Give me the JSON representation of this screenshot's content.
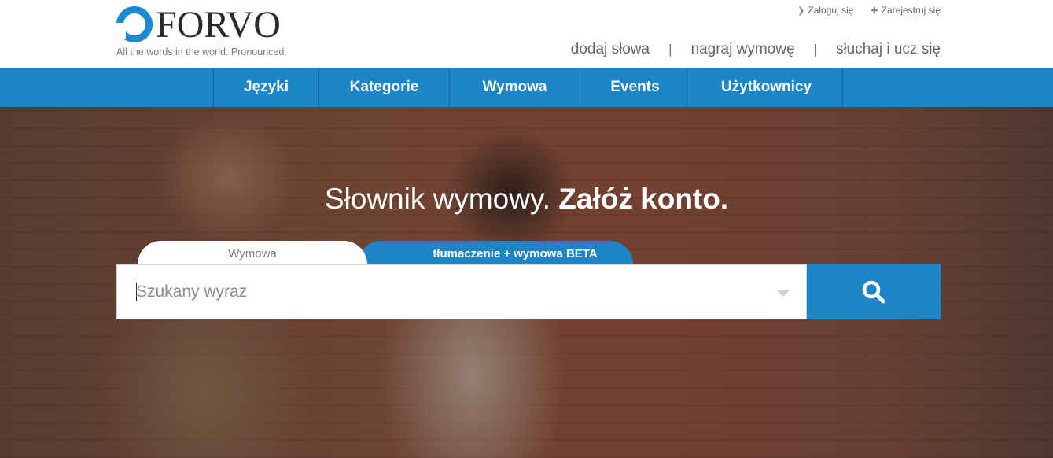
{
  "logo": {
    "name": "FORVO",
    "tagline": "All the words in the world. Pronounced."
  },
  "top_links": {
    "login": "Zaloguj się",
    "register": "Zarejestruj się"
  },
  "secondary_links": {
    "add_words": "dodaj słowa",
    "record": "nagraj wymowę",
    "listen": "słuchaj i ucz się",
    "separator": "|"
  },
  "nav": {
    "items": [
      {
        "label": "Języki"
      },
      {
        "label": "Kategorie"
      },
      {
        "label": "Wymowa"
      },
      {
        "label": "Events"
      },
      {
        "label": "Użytkownicy"
      }
    ]
  },
  "hero": {
    "title_regular": "Słownik wymowy.",
    "title_bold": "Załóż konto."
  },
  "search": {
    "tab_pronunciation": "Wymowa",
    "tab_translation": "tłumaczenie + wymowa BETA",
    "placeholder": "Szukany wyraz",
    "value": ""
  },
  "colors": {
    "brand_blue": "#1f85c9",
    "logo_blue": "#1a8bd0"
  },
  "icons": {
    "login": "chevron-right-icon",
    "register": "plus-icon",
    "search": "magnifier-icon",
    "dropdown": "caret-down-icon"
  }
}
